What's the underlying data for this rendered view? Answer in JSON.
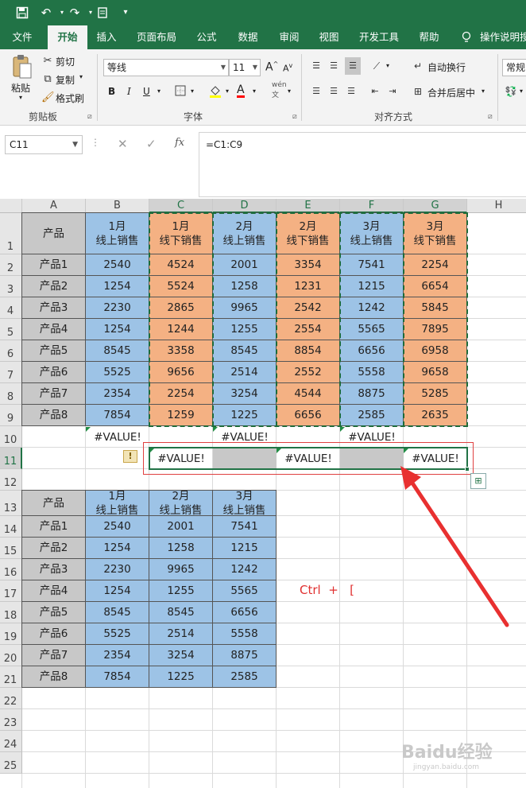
{
  "colors": {
    "excel_green": "#217346",
    "header_gray": "#c8c8c8",
    "blue_fill": "#9dc3e6",
    "orange_fill": "#f4b183",
    "annotation_red": "#e03030"
  },
  "qat": {
    "icons": [
      "save-icon",
      "undo-icon",
      "redo-icon",
      "print-preview-icon",
      "customize-icon"
    ]
  },
  "tabs": [
    "文件",
    "开始",
    "插入",
    "页面布局",
    "公式",
    "数据",
    "审阅",
    "视图",
    "开发工具",
    "帮助",
    "操作说明搜"
  ],
  "active_tab": "开始",
  "ribbon": {
    "clipboard": {
      "paste": "粘贴",
      "cut": "剪切",
      "copy": "复制",
      "format_painter": "格式刷",
      "group": "剪贴板"
    },
    "font": {
      "name": "等线",
      "size": "11",
      "bold": "B",
      "italic": "I",
      "underline": "U",
      "grow": "A",
      "shrink": "A",
      "font_color": "A",
      "group": "字体",
      "wen": "wén"
    },
    "alignment": {
      "wrap": "自动换行",
      "merge": "合并后居中",
      "group": "对齐方式"
    },
    "number": {
      "format": "常规"
    }
  },
  "formula_bar": {
    "name_box": "C11",
    "formula": "=C1:C9",
    "cancel": "✕",
    "enter": "✓",
    "fx": "fx"
  },
  "columns": [
    "A",
    "B",
    "C",
    "D",
    "E",
    "F",
    "G",
    "H"
  ],
  "rows": [
    "1",
    "2",
    "3",
    "4",
    "5",
    "6",
    "7",
    "8",
    "9",
    "10",
    "11",
    "12",
    "13",
    "14",
    "15",
    "16",
    "17",
    "18",
    "19",
    "20",
    "21",
    "22",
    "23",
    "24",
    "25"
  ],
  "table1": {
    "header": [
      "产品",
      "1月\n线上销售",
      "1月\n线下销售",
      "2月\n线上销售",
      "2月\n线下销售",
      "3月\n线上销售",
      "3月\n线下销售"
    ],
    "rows": [
      [
        "产品1",
        "2540",
        "4524",
        "2001",
        "3354",
        "7541",
        "2254"
      ],
      [
        "产品2",
        "1254",
        "5524",
        "1258",
        "1231",
        "1215",
        "6654"
      ],
      [
        "产品3",
        "2230",
        "2865",
        "9965",
        "2542",
        "1242",
        "5845"
      ],
      [
        "产品4",
        "1254",
        "1244",
        "1255",
        "2554",
        "5565",
        "7895"
      ],
      [
        "产品5",
        "8545",
        "3358",
        "8545",
        "8854",
        "6656",
        "6958"
      ],
      [
        "产品6",
        "5525",
        "9656",
        "2514",
        "2552",
        "5558",
        "9658"
      ],
      [
        "产品7",
        "2354",
        "2254",
        "3254",
        "4544",
        "8875",
        "5285"
      ],
      [
        "产品8",
        "7854",
        "1259",
        "1225",
        "6656",
        "2585",
        "2635"
      ]
    ]
  },
  "row10": {
    "B": "#VALUE!",
    "D": "#VALUE!",
    "F": "#VALUE!"
  },
  "row11": {
    "C": "#VALUE!",
    "E": "#VALUE!",
    "G": "#VALUE!"
  },
  "warning_icon": "!",
  "table2": {
    "header": [
      "产品",
      "1月\n线上销售",
      "2月\n线上销售",
      "3月\n线上销售"
    ],
    "rows": [
      [
        "产品1",
        "2540",
        "2001",
        "7541"
      ],
      [
        "产品2",
        "1254",
        "1258",
        "1215"
      ],
      [
        "产品3",
        "2230",
        "9965",
        "1242"
      ],
      [
        "产品4",
        "1254",
        "1255",
        "5565"
      ],
      [
        "产品5",
        "8545",
        "8545",
        "6656"
      ],
      [
        "产品6",
        "5525",
        "2514",
        "5558"
      ],
      [
        "产品7",
        "2354",
        "3254",
        "8875"
      ],
      [
        "产品8",
        "7854",
        "1225",
        "2585"
      ]
    ]
  },
  "annotation": {
    "text": "Ctrl  +   ["
  },
  "watermark": {
    "text": "Baidu经验",
    "sub": "jingyan.baidu.com"
  }
}
